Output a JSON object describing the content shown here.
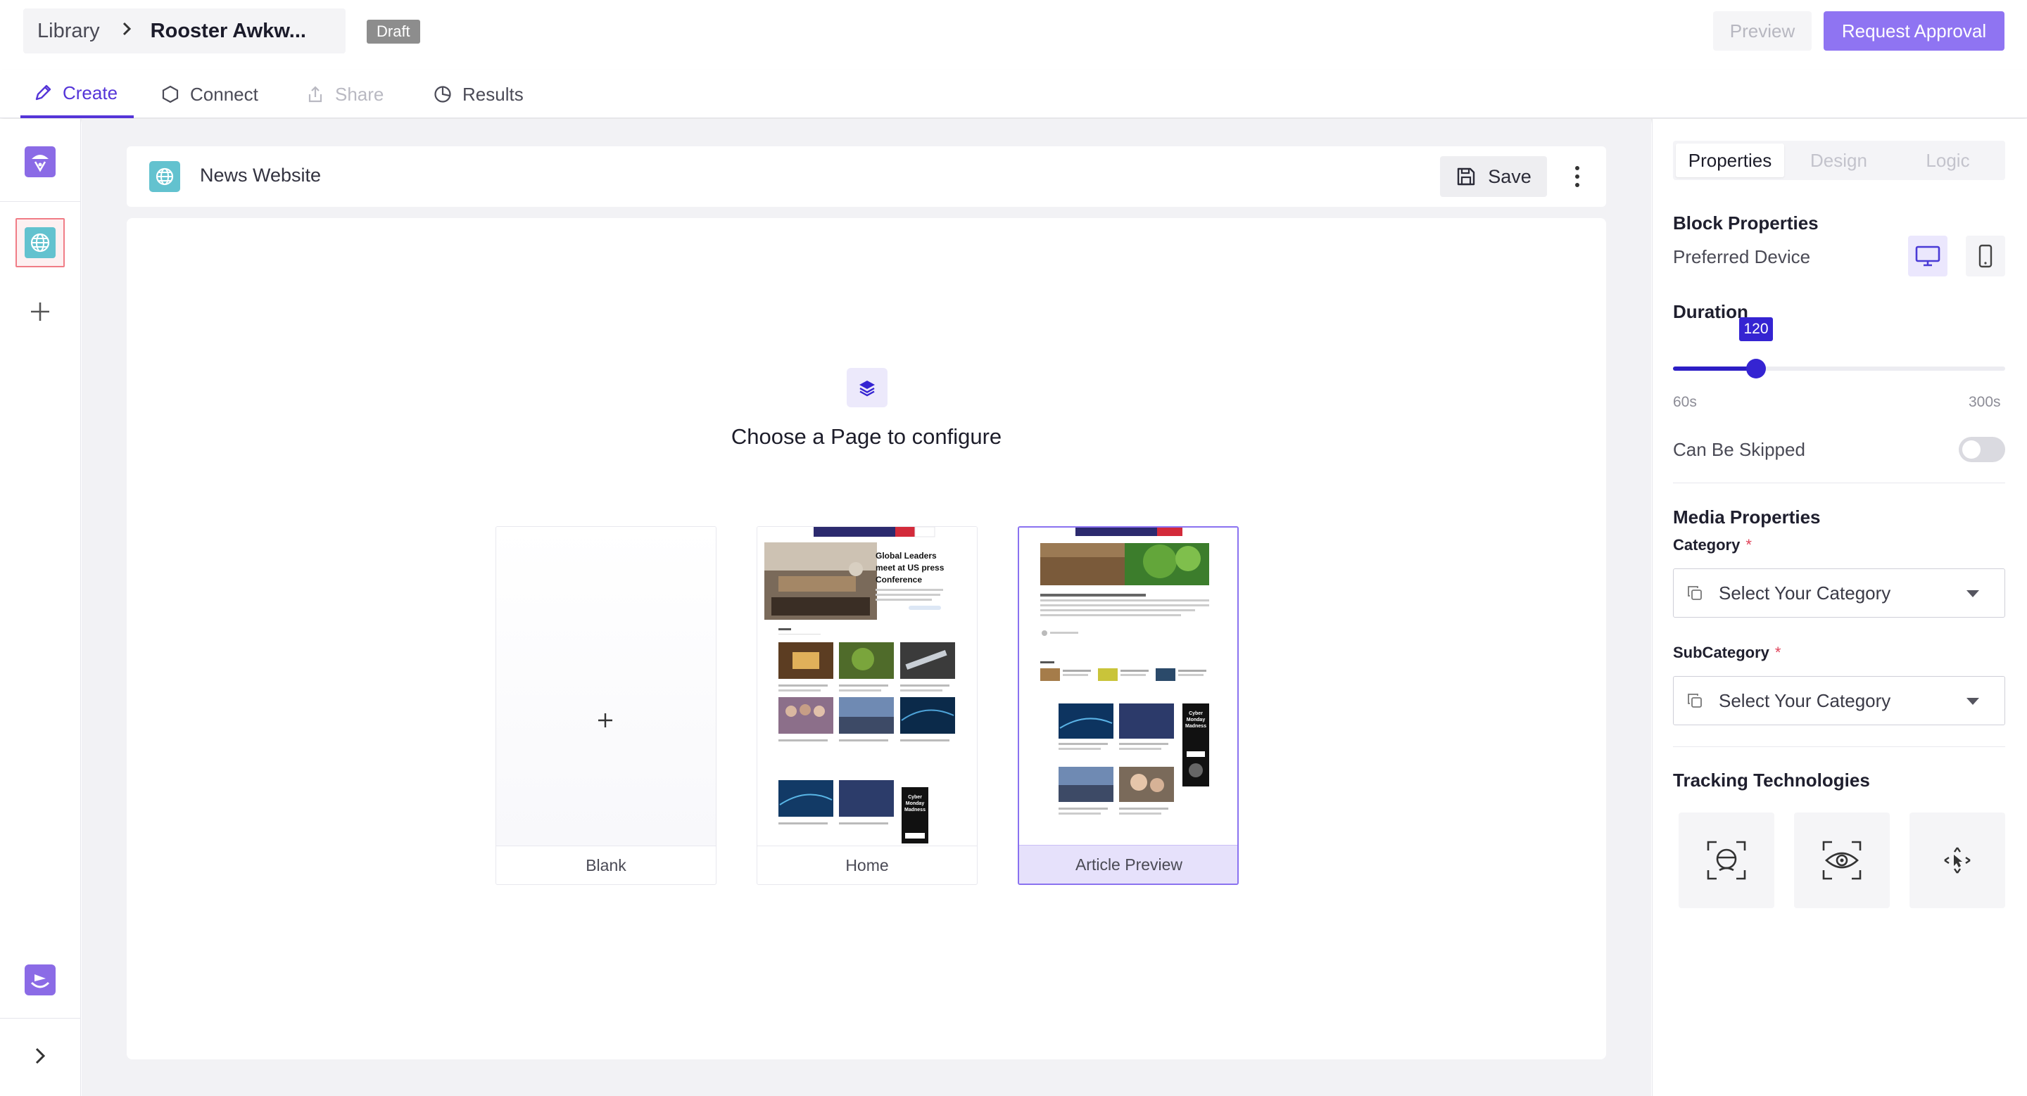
{
  "header": {
    "breadcrumb_root": "Library",
    "breadcrumb_title": "Rooster Awkw...",
    "status_badge": "Draft",
    "preview_label": "Preview",
    "request_label": "Request Approval"
  },
  "tabs": [
    {
      "label": "Create",
      "icon": "pencil-icon",
      "state": "active"
    },
    {
      "label": "Connect",
      "icon": "hexagon-icon",
      "state": "normal"
    },
    {
      "label": "Share",
      "icon": "share-icon",
      "state": "disabled"
    },
    {
      "label": "Results",
      "icon": "pie-chart-icon",
      "state": "normal"
    }
  ],
  "rail": {
    "items": [
      "ad-block-icon",
      "globe-block-icon",
      "add-icon"
    ],
    "bottom": [
      "brand-logo-icon",
      "expand-chevron-icon"
    ]
  },
  "page": {
    "name": "News Website",
    "save_label": "Save",
    "choose_title": "Choose a Page to configure",
    "templates": [
      {
        "label": "Blank",
        "selected": false
      },
      {
        "label": "Home",
        "selected": false
      },
      {
        "label": "Article Preview",
        "selected": true
      }
    ],
    "home_headline": "Global Leaders meet at US press Conference",
    "promo_text": "Cyber Monday Madness",
    "promo_button": "Shop Now"
  },
  "panel": {
    "tabs": [
      {
        "label": "Properties",
        "state": "active"
      },
      {
        "label": "Design",
        "state": "disabled"
      },
      {
        "label": "Logic",
        "state": "disabled"
      }
    ],
    "block_properties": "Block Properties",
    "preferred_device": "Preferred Device",
    "duration_label": "Duration",
    "duration_value": "120",
    "duration_min": "60s",
    "duration_max": "300s",
    "duration_fraction": 0.25,
    "can_be_skipped": "Can Be Skipped",
    "media_properties": "Media Properties",
    "category_label": "Category",
    "category_placeholder": "Select Your Category",
    "subcategory_label": "SubCategory",
    "subcategory_placeholder": "Select Your Category",
    "required_mark": "*",
    "tracking_title": "Tracking Technologies",
    "tracking_icons": [
      "face-tracking-icon",
      "eye-tracking-icon",
      "cursor-tracking-icon"
    ]
  },
  "colors": {
    "accent": "#5535d8",
    "approval_button": "#8f74f2",
    "slider": "#3524d2",
    "globe_tile": "#63c2cf"
  }
}
